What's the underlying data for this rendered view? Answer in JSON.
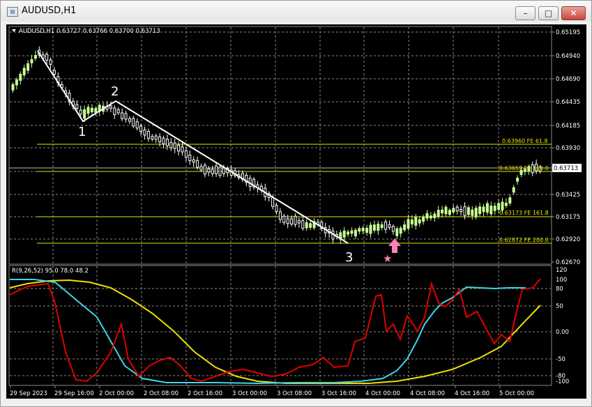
{
  "window": {
    "title": "AUDUSD,H1",
    "buttons": {
      "minimize": "–",
      "maximize": "□",
      "close": "✕"
    }
  },
  "main_panel": {
    "header": "AUDUSD,H1  0.63727 0.63766 0.63700 0.63713",
    "price_scale": [
      "0.65195",
      "0.64940",
      "0.64690",
      "0.64435",
      "0.64185",
      "0.63930",
      "0.63425",
      "0.63175",
      "0.62920",
      "0.62670"
    ],
    "current_price": "0.63713",
    "fib_levels": [
      {
        "label": "0.63960 FE 61.8"
      },
      {
        "label": "0.63659 FE 100.0"
      },
      {
        "label": "0.63173 FE 161.8"
      },
      {
        "label": "0.62872 FE 200.0"
      }
    ],
    "wave_labels": [
      "1",
      "2",
      "3"
    ],
    "star_symbol": "★"
  },
  "sub_panel": {
    "header": "R(9,26,52) 95.0 78.0 48.2",
    "scale": [
      "120",
      "100",
      "80",
      "50",
      "0.00",
      "-50",
      "-80",
      "-100"
    ]
  },
  "time_axis": [
    "29 Sep 2023",
    "29 Sep 16:00",
    "2 Oct 00:00",
    "2 Oct 08:00",
    "2 Oct 16:00",
    "3 Oct 00:00",
    "3 Oct 08:00",
    "3 Oct 16:00",
    "4 Oct 00:00",
    "4 Oct 08:00",
    "4 Oct 16:00",
    "5 Oct 00:00"
  ],
  "colors": {
    "background": "#000000",
    "grid": "#8a8a8a",
    "bull_candle": "#c8ff96",
    "bear_candle": "#ffffff",
    "fib_line": "#e6e600",
    "wave_line": "#ffffff",
    "arrow": "#ff7fb4",
    "indicator_fast": "#e00000",
    "indicator_mid": "#3fd6e6",
    "indicator_slow": "#f0e000"
  }
}
